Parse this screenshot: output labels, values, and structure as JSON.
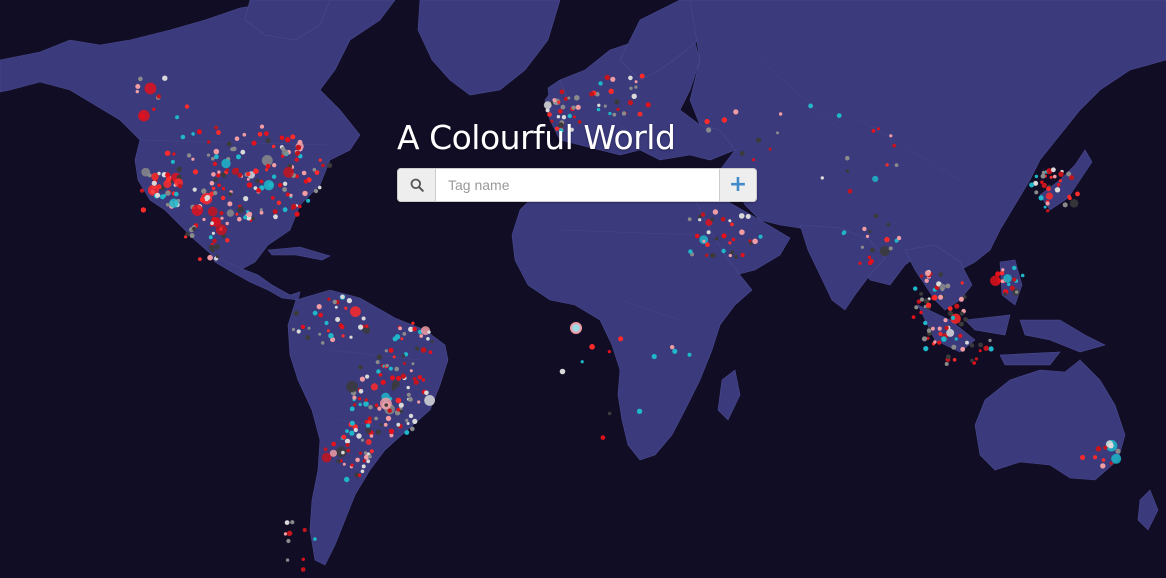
{
  "app": {
    "title": "A Colourful World"
  },
  "search": {
    "placeholder": "Tag name",
    "value": "",
    "search_icon": "search-icon",
    "add_icon": "plus-icon"
  },
  "map": {
    "ocean_color": "#110d25",
    "land_color": "#3a3a7d",
    "dot_colors": [
      "#e2111b",
      "#ff2a2a",
      "#c4141c",
      "#f19ca3",
      "#d9d9d9",
      "#3b3b3b",
      "#1fb7c9",
      "#8a8a8a"
    ]
  }
}
